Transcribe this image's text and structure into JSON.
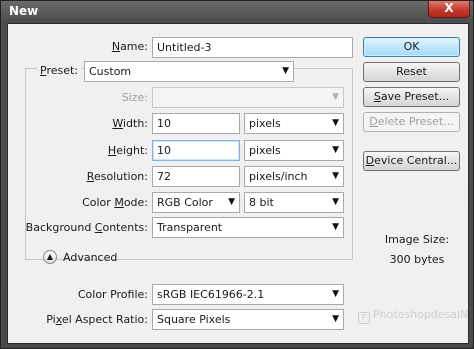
{
  "window": {
    "title": "New",
    "close_label": "X"
  },
  "form": {
    "name": {
      "label": "Name:",
      "value": "Untitled-3"
    },
    "preset": {
      "label": "Preset:",
      "value": "Custom"
    },
    "size": {
      "label": "Size:",
      "value": ""
    },
    "width": {
      "label": "Width:",
      "value": "10",
      "unit": "pixels"
    },
    "height": {
      "label": "Height:",
      "value": "10",
      "unit": "pixels"
    },
    "resolution": {
      "label": "Resolution:",
      "value": "72",
      "unit": "pixels/inch"
    },
    "color_mode": {
      "label": "Color Mode:",
      "value": "RGB Color",
      "depth": "8 bit"
    },
    "background": {
      "label": "Background Contents:",
      "value": "Transparent"
    },
    "advanced_label": "Advanced",
    "color_profile": {
      "label": "Color Profile:",
      "value": "sRGB IEC61966-2.1"
    },
    "pixel_aspect": {
      "label": "Pixel Aspect Ratio:",
      "value": "Square Pixels"
    }
  },
  "buttons": {
    "ok": "OK",
    "reset": "Reset",
    "save_preset": "Save Preset...",
    "delete_preset": "Delete Preset...",
    "device_central": "Device Central..."
  },
  "info": {
    "image_size_label": "Image Size:",
    "image_size_value": "300 bytes"
  },
  "watermark": "PhotoshopdesaiN",
  "icons": {
    "dropdown": "chevron-down-icon",
    "advanced_toggle": "chevron-up-circle-icon",
    "watermark_logo": "logo-icon"
  }
}
